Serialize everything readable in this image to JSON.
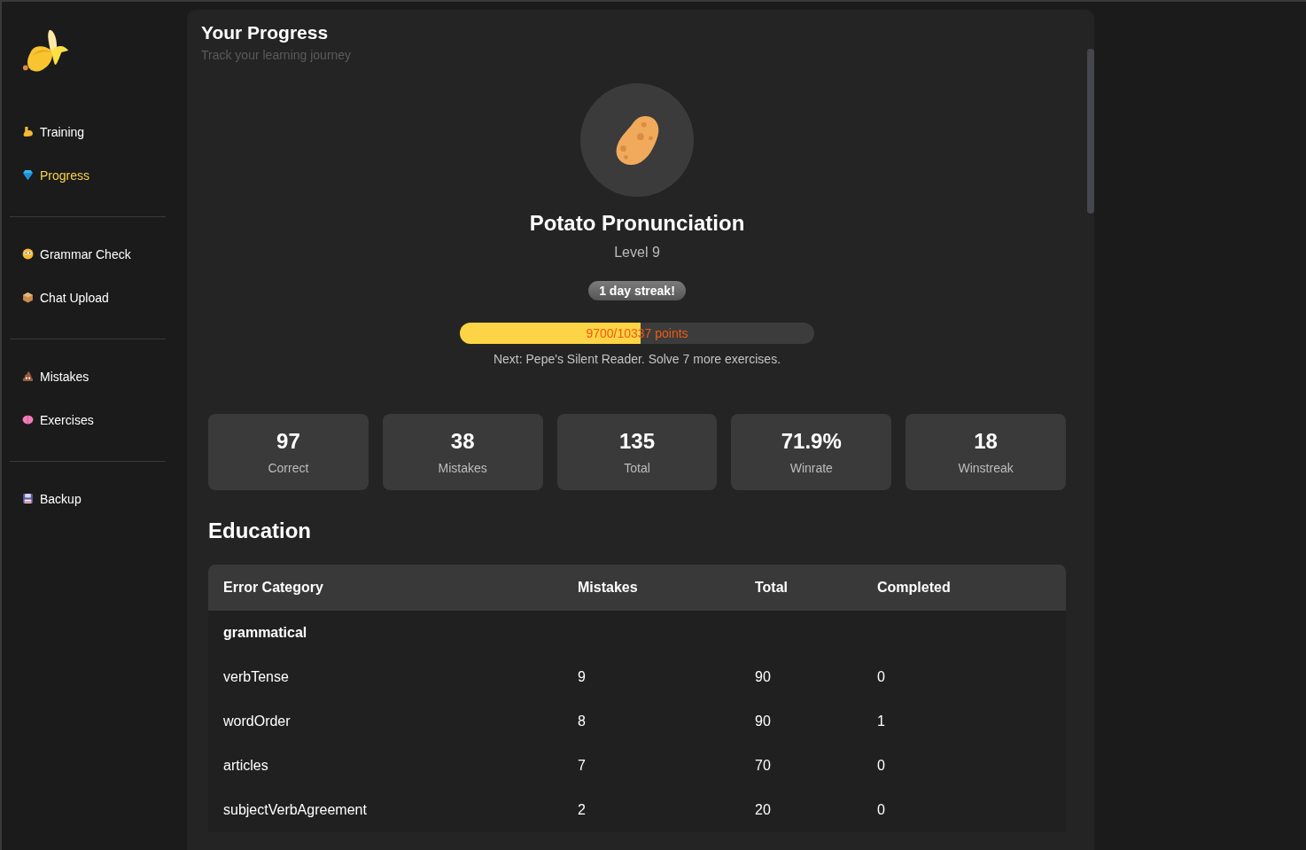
{
  "sidebar": {
    "sections": [
      {
        "items": [
          {
            "label": "Training",
            "selected": false
          },
          {
            "label": "Progress",
            "selected": true
          }
        ]
      },
      {
        "items": [
          {
            "label": "Grammar Check",
            "selected": false
          },
          {
            "label": "Chat Upload",
            "selected": false
          }
        ]
      },
      {
        "items": [
          {
            "label": "Mistakes",
            "selected": false
          },
          {
            "label": "Exercises",
            "selected": false
          }
        ]
      },
      {
        "items": [
          {
            "label": "Backup",
            "selected": false
          }
        ]
      }
    ]
  },
  "header": {
    "title": "Your Progress",
    "subtitle": "Track your learning journey"
  },
  "rank": {
    "name": "Potato Pronunciation",
    "level": "Level 9",
    "streak": "1 day streak!",
    "progress": {
      "level": 0.51,
      "label": "9700/10337 points"
    },
    "next": "Next: Pepe's Silent Reader. Solve 7 more exercises."
  },
  "stats": [
    {
      "value": "97",
      "label": "Correct"
    },
    {
      "value": "38",
      "label": "Mistakes"
    },
    {
      "value": "135",
      "label": "Total"
    },
    {
      "value": "71.9%",
      "label": "Winrate"
    },
    {
      "value": "18",
      "label": "Winstreak"
    }
  ],
  "education": {
    "title": "Education",
    "table": {
      "columns": [
        "Error Category",
        "Mistakes",
        "Total",
        "Completed"
      ],
      "rows": [
        {
          "kind": "group",
          "cells": [
            "grammatical"
          ]
        },
        {
          "kind": "row",
          "cells": [
            "verbTense",
            "9",
            "90",
            "0"
          ]
        },
        {
          "kind": "row",
          "cells": [
            "wordOrder",
            "8",
            "90",
            "1"
          ]
        },
        {
          "kind": "row",
          "cells": [
            "articles",
            "7",
            "70",
            "0"
          ]
        },
        {
          "kind": "row",
          "cells": [
            "subjectVerbAgreement",
            "2",
            "20",
            "0"
          ]
        }
      ]
    }
  }
}
